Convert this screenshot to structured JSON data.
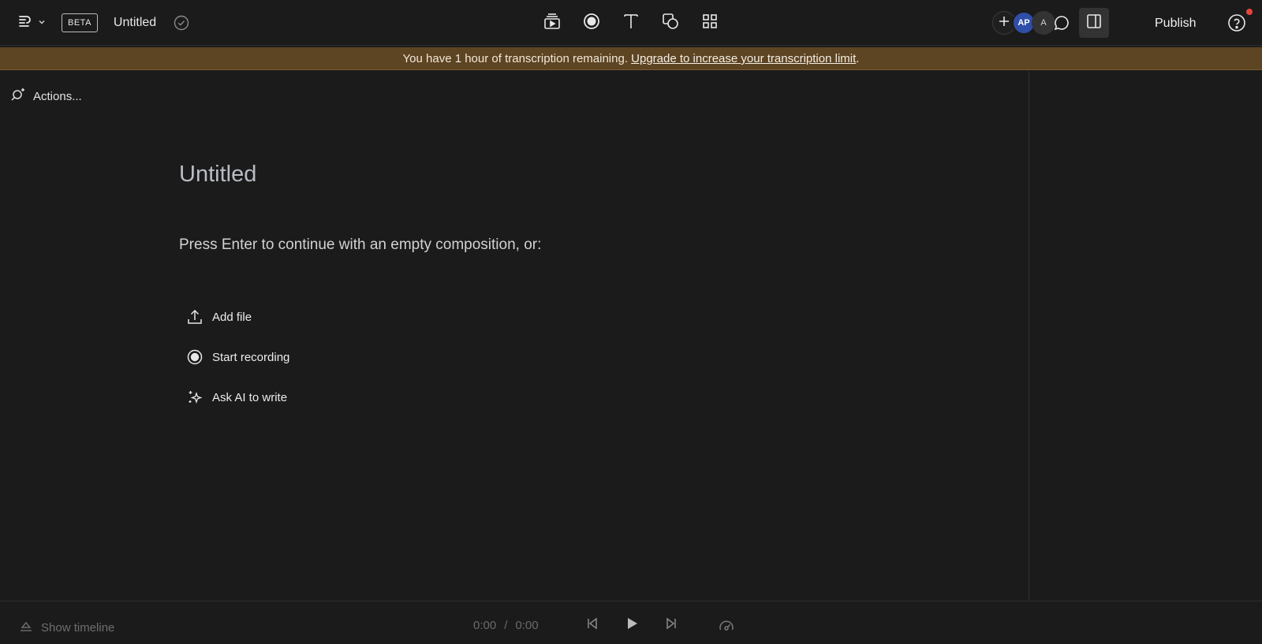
{
  "header": {
    "beta_label": "BETA",
    "doc_title": "Untitled",
    "publish_label": "Publish",
    "avatars": [
      "AP",
      "A"
    ],
    "tools": [
      "scene-icon",
      "record-icon",
      "text-icon",
      "shapes-icon",
      "grid-icon"
    ]
  },
  "banner": {
    "text": "You have 1 hour of transcription remaining. ",
    "link": "Upgrade to increase your transcription limit",
    "suffix": "."
  },
  "editor": {
    "actions_label": "Actions...",
    "title_placeholder": "Untitled",
    "hint": "Press Enter to continue with an empty composition, or:",
    "options": [
      {
        "label": "Add file",
        "icon": "upload-icon"
      },
      {
        "label": "Start recording",
        "icon": "record-icon"
      },
      {
        "label": "Ask AI to write",
        "icon": "sparkle-icon"
      }
    ]
  },
  "footer": {
    "show_timeline_label": "Show timeline",
    "current_time": "0:00",
    "separator": "/",
    "total_time": "0:00"
  },
  "colors": {
    "background": "#1b1b1b",
    "banner": "#5d4423",
    "avatar_primary": "#2e4ea8",
    "notification": "#e8453c"
  }
}
